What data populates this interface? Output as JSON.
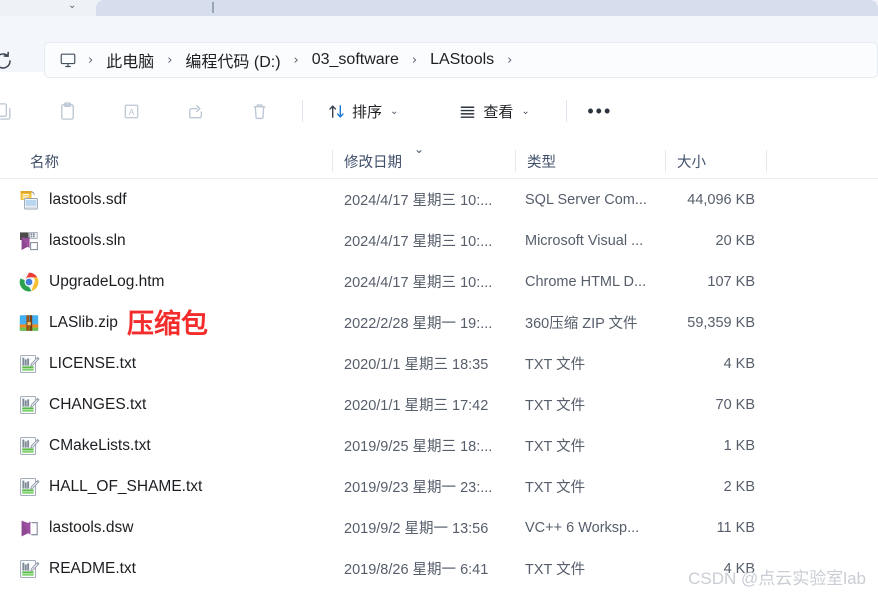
{
  "window": {
    "tab_caret_icon": "chevron-down-icon",
    "refresh_icon": "refresh-icon"
  },
  "addressbar": {
    "pc_icon": "this-pc-monitor-icon",
    "separator": "›",
    "crumbs": [
      {
        "label": "此电脑"
      },
      {
        "label": "编程代码 (D:)"
      },
      {
        "label": "03_software"
      },
      {
        "label": "LAStools"
      }
    ]
  },
  "toolbar": {
    "items": [
      {
        "name": "copy-button",
        "icon": "copy-icon",
        "label": "",
        "disabled": true
      },
      {
        "name": "paste-button",
        "icon": "paste-icon",
        "label": "",
        "disabled": true
      },
      {
        "name": "rename-button",
        "icon": "rename-icon",
        "label": "",
        "disabled": true
      },
      {
        "name": "share-button",
        "icon": "share-icon",
        "label": "",
        "disabled": true
      },
      {
        "name": "delete-button",
        "icon": "trash-icon",
        "label": "",
        "disabled": true
      }
    ],
    "sort_label": "排序",
    "sort_icon": "sort-arrows-icon",
    "view_label": "查看",
    "view_icon": "view-list-icon",
    "caret": "⌄",
    "more_label": "•••"
  },
  "columns": {
    "name": "名称",
    "date_modified": "修改日期",
    "type": "类型",
    "size": "大小",
    "sort_indicator": "⌄"
  },
  "files": [
    {
      "name": "lastools.sdf",
      "icon": "sql-server-file-icon",
      "date": "2024/4/17 星期三 10:...",
      "type": "SQL Server Com...",
      "size": "44,096 KB"
    },
    {
      "name": "lastools.sln",
      "icon": "visual-studio-solution-icon",
      "date": "2024/4/17 星期三 10:...",
      "type": "Microsoft Visual ...",
      "size": "20 KB"
    },
    {
      "name": "UpgradeLog.htm",
      "icon": "chrome-html-icon",
      "date": "2024/4/17 星期三 10:...",
      "type": "Chrome HTML D...",
      "size": "107 KB"
    },
    {
      "name": "LASlib.zip",
      "icon": "zip-archive-icon",
      "date": "2022/2/28 星期一 19:...",
      "type": "360压缩 ZIP 文件",
      "size": "59,359 KB"
    },
    {
      "name": "LICENSE.txt",
      "icon": "txt-file-icon",
      "date": "2020/1/1 星期三 18:35",
      "type": "TXT 文件",
      "size": "4 KB"
    },
    {
      "name": "CHANGES.txt",
      "icon": "txt-file-icon",
      "date": "2020/1/1 星期三 17:42",
      "type": "TXT 文件",
      "size": "70 KB"
    },
    {
      "name": "CMakeLists.txt",
      "icon": "txt-file-icon",
      "date": "2019/9/25 星期三 18:...",
      "type": "TXT 文件",
      "size": "1 KB"
    },
    {
      "name": "HALL_OF_SHAME.txt",
      "icon": "txt-file-icon",
      "date": "2019/9/23 星期一 23:...",
      "type": "TXT 文件",
      "size": "2 KB"
    },
    {
      "name": "lastools.dsw",
      "icon": "visual-studio-workspace-icon",
      "date": "2019/9/2 星期一 13:56",
      "type": "VC++ 6 Worksp...",
      "size": "11 KB"
    },
    {
      "name": "README.txt",
      "icon": "txt-file-icon",
      "date": "2019/8/26 星期一 6:41",
      "type": "TXT 文件",
      "size": "4 KB"
    }
  ],
  "annotations": [
    {
      "text": "压缩包",
      "color": "#f42c2c",
      "target_row": 3
    }
  ],
  "watermark": {
    "text": "CSDN @点云实验室lab",
    "color": "#c9cdd4"
  }
}
